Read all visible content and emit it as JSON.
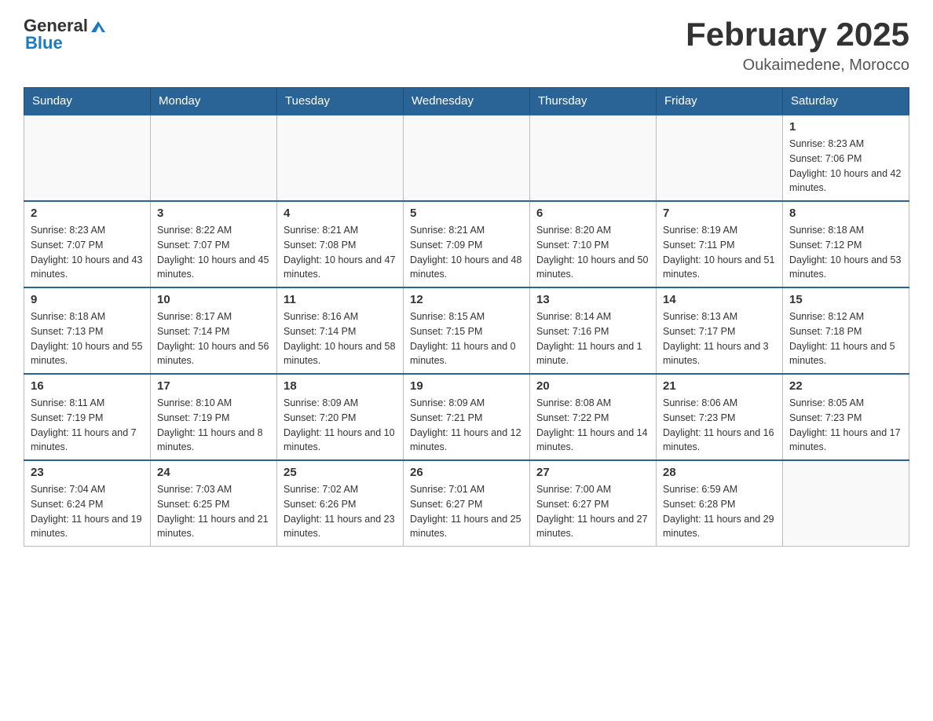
{
  "header": {
    "logo_general": "General",
    "logo_blue": "Blue",
    "month_title": "February 2025",
    "location": "Oukaimedene, Morocco"
  },
  "weekdays": [
    "Sunday",
    "Monday",
    "Tuesday",
    "Wednesday",
    "Thursday",
    "Friday",
    "Saturday"
  ],
  "weeks": [
    {
      "days": [
        {
          "num": "",
          "info": ""
        },
        {
          "num": "",
          "info": ""
        },
        {
          "num": "",
          "info": ""
        },
        {
          "num": "",
          "info": ""
        },
        {
          "num": "",
          "info": ""
        },
        {
          "num": "",
          "info": ""
        },
        {
          "num": "1",
          "info": "Sunrise: 8:23 AM\nSunset: 7:06 PM\nDaylight: 10 hours and 42 minutes."
        }
      ]
    },
    {
      "days": [
        {
          "num": "2",
          "info": "Sunrise: 8:23 AM\nSunset: 7:07 PM\nDaylight: 10 hours and 43 minutes."
        },
        {
          "num": "3",
          "info": "Sunrise: 8:22 AM\nSunset: 7:07 PM\nDaylight: 10 hours and 45 minutes."
        },
        {
          "num": "4",
          "info": "Sunrise: 8:21 AM\nSunset: 7:08 PM\nDaylight: 10 hours and 47 minutes."
        },
        {
          "num": "5",
          "info": "Sunrise: 8:21 AM\nSunset: 7:09 PM\nDaylight: 10 hours and 48 minutes."
        },
        {
          "num": "6",
          "info": "Sunrise: 8:20 AM\nSunset: 7:10 PM\nDaylight: 10 hours and 50 minutes."
        },
        {
          "num": "7",
          "info": "Sunrise: 8:19 AM\nSunset: 7:11 PM\nDaylight: 10 hours and 51 minutes."
        },
        {
          "num": "8",
          "info": "Sunrise: 8:18 AM\nSunset: 7:12 PM\nDaylight: 10 hours and 53 minutes."
        }
      ]
    },
    {
      "days": [
        {
          "num": "9",
          "info": "Sunrise: 8:18 AM\nSunset: 7:13 PM\nDaylight: 10 hours and 55 minutes."
        },
        {
          "num": "10",
          "info": "Sunrise: 8:17 AM\nSunset: 7:14 PM\nDaylight: 10 hours and 56 minutes."
        },
        {
          "num": "11",
          "info": "Sunrise: 8:16 AM\nSunset: 7:14 PM\nDaylight: 10 hours and 58 minutes."
        },
        {
          "num": "12",
          "info": "Sunrise: 8:15 AM\nSunset: 7:15 PM\nDaylight: 11 hours and 0 minutes."
        },
        {
          "num": "13",
          "info": "Sunrise: 8:14 AM\nSunset: 7:16 PM\nDaylight: 11 hours and 1 minute."
        },
        {
          "num": "14",
          "info": "Sunrise: 8:13 AM\nSunset: 7:17 PM\nDaylight: 11 hours and 3 minutes."
        },
        {
          "num": "15",
          "info": "Sunrise: 8:12 AM\nSunset: 7:18 PM\nDaylight: 11 hours and 5 minutes."
        }
      ]
    },
    {
      "days": [
        {
          "num": "16",
          "info": "Sunrise: 8:11 AM\nSunset: 7:19 PM\nDaylight: 11 hours and 7 minutes."
        },
        {
          "num": "17",
          "info": "Sunrise: 8:10 AM\nSunset: 7:19 PM\nDaylight: 11 hours and 8 minutes."
        },
        {
          "num": "18",
          "info": "Sunrise: 8:09 AM\nSunset: 7:20 PM\nDaylight: 11 hours and 10 minutes."
        },
        {
          "num": "19",
          "info": "Sunrise: 8:09 AM\nSunset: 7:21 PM\nDaylight: 11 hours and 12 minutes."
        },
        {
          "num": "20",
          "info": "Sunrise: 8:08 AM\nSunset: 7:22 PM\nDaylight: 11 hours and 14 minutes."
        },
        {
          "num": "21",
          "info": "Sunrise: 8:06 AM\nSunset: 7:23 PM\nDaylight: 11 hours and 16 minutes."
        },
        {
          "num": "22",
          "info": "Sunrise: 8:05 AM\nSunset: 7:23 PM\nDaylight: 11 hours and 17 minutes."
        }
      ]
    },
    {
      "days": [
        {
          "num": "23",
          "info": "Sunrise: 7:04 AM\nSunset: 6:24 PM\nDaylight: 11 hours and 19 minutes."
        },
        {
          "num": "24",
          "info": "Sunrise: 7:03 AM\nSunset: 6:25 PM\nDaylight: 11 hours and 21 minutes."
        },
        {
          "num": "25",
          "info": "Sunrise: 7:02 AM\nSunset: 6:26 PM\nDaylight: 11 hours and 23 minutes."
        },
        {
          "num": "26",
          "info": "Sunrise: 7:01 AM\nSunset: 6:27 PM\nDaylight: 11 hours and 25 minutes."
        },
        {
          "num": "27",
          "info": "Sunrise: 7:00 AM\nSunset: 6:27 PM\nDaylight: 11 hours and 27 minutes."
        },
        {
          "num": "28",
          "info": "Sunrise: 6:59 AM\nSunset: 6:28 PM\nDaylight: 11 hours and 29 minutes."
        },
        {
          "num": "",
          "info": ""
        }
      ]
    }
  ]
}
